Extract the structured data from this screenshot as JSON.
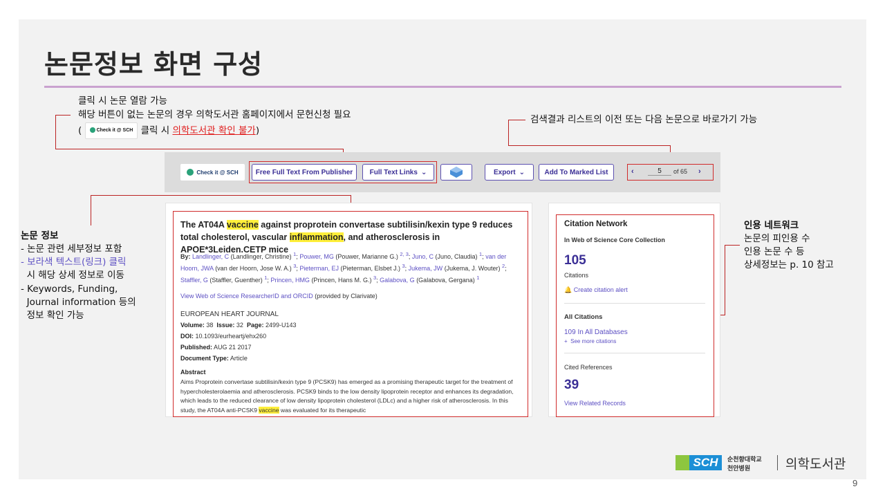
{
  "slide": {
    "title": "논문정보 화면 구성",
    "page_number": "9"
  },
  "notes": {
    "top_left": {
      "line1": "클릭 시 논문 열람 가능",
      "line2": "해당 버튼이 없는 논문의 경우 의학도서관 홈페이지에서 문헌신청 필요",
      "line3_prefix": "(",
      "line3_badge": "Check it @ SCH",
      "line3_middle": "클릭 시 ",
      "line3_link": "의학도서관 확인 불가",
      "line3_suffix": ")"
    },
    "top_right": "검색결과 리스트의 이전 또는 다음 논문으로 바로가기 가능",
    "left": {
      "heading": "논문 정보",
      "item1": "- 논문 관련 세부정보 포함",
      "item2a": "- 보라색 텍스트(링크) 클릭",
      "item2b": "  시 해당 상세 정보로 이동",
      "item3a": "- Keywords, Funding,",
      "item3b": "  Journal information 등의",
      "item3c": "  정보 확인 가능"
    },
    "right": {
      "heading": "인용 네트워크",
      "line1": "논문의 피인용 수",
      "line2": "인용 논문 수 등",
      "line3": "상세정보는 p. 10 참고"
    }
  },
  "toolbar": {
    "check_label": "Check it @ SCH",
    "free_full_text": "Free Full Text From Publisher",
    "full_text_links": "Full Text Links",
    "export": "Export",
    "add_marked": "Add To Marked List",
    "page_value": "5",
    "page_total": "of 65"
  },
  "article": {
    "title_p1": "The AT04A ",
    "title_hl1": "vaccine",
    "title_p2": " against proprotein convertase subtilisin/kexin type 9 reduces total cholesterol, vascular ",
    "title_hl2": "inflammation",
    "title_p3": ", and atherosclerosis in APOE*3Leiden.CETP mice",
    "by_label": "By:",
    "authors": [
      {
        "name": "Landlinger, C",
        "full": "(Landlinger, Christine)",
        "sup": "1"
      },
      {
        "name": "Pouwer, MG",
        "full": "(Pouwer, Marianne G.)",
        "sup": "2, 3"
      },
      {
        "name": "Juno, C",
        "full": "(Juno, Claudia)",
        "sup": "1"
      },
      {
        "name": "van der Hoorn, JWA",
        "full": "(van der Hoorn, Jose W. A.)",
        "sup": "3"
      },
      {
        "name": "Pieterman, EJ",
        "full": "(Pieterman, Elsbet J.)",
        "sup": "3"
      },
      {
        "name": "Jukema, JW",
        "full": "(Jukema, J. Wouter)",
        "sup": "2"
      },
      {
        "name": "Staffler, G",
        "full": "(Staffler, Guenther)",
        "sup": "1"
      },
      {
        "name": "Princen, HMG",
        "full": "(Princen, Hans M. G.)",
        "sup": "3"
      },
      {
        "name": "Galabova, G",
        "full": "(Galabova, Gergana)",
        "sup": "1"
      }
    ],
    "researcher_link": "View Web of Science ResearcherID and ORCID",
    "researcher_suffix": " (provided by Clarivate)",
    "journal": "EUROPEAN HEART JOURNAL",
    "volume_label": "Volume:",
    "volume": "38",
    "issue_label": "Issue:",
    "issue": "32",
    "page_label": "Page:",
    "pages": "2499-U143",
    "doi_label": "DOI:",
    "doi": "10.1093/eurheartj/ehx260",
    "published_label": "Published:",
    "published": "AUG 21 2017",
    "doctype_label": "Document Type:",
    "doctype": "Article",
    "abstract_label": "Abstract",
    "abstract_p1": "Aims Proprotein convertase subtilisin/kexin type 9 (PCSK9) has emerged as a promising therapeutic target for the treatment of hypercholesterolaemia and atherosclerosis. PCSK9 binds to the low density lipoprotein receptor and enhances its degradation, which leads to the reduced clearance of low density lipoprotein cholesterol (LDLc) and a higher risk of atherosclerosis. In this study, the AT04A anti-PCSK9 ",
    "abstract_hl": "vaccine",
    "abstract_p2": " was evaluated for its therapeutic"
  },
  "citation": {
    "title": "Citation Network",
    "collection": "In Web of Science Core Collection",
    "count": "105",
    "count_label": "Citations",
    "alert": "Create citation alert",
    "all_label": "All Citations",
    "all_value": "109 In All Databases",
    "more": "See more citations",
    "cited_label": "Cited References",
    "cited_value": "39",
    "related": "View Related Records"
  },
  "logo": {
    "sch": "SCH",
    "hospital_line1": "순천향대학교",
    "hospital_line2": "천안병원",
    "library": "의학도서관"
  },
  "colors": {
    "accent_red": "#d02a2a",
    "link_purple": "#5c4fc3",
    "highlight": "#ffef3a",
    "title_rule": "#c9a2cf"
  }
}
